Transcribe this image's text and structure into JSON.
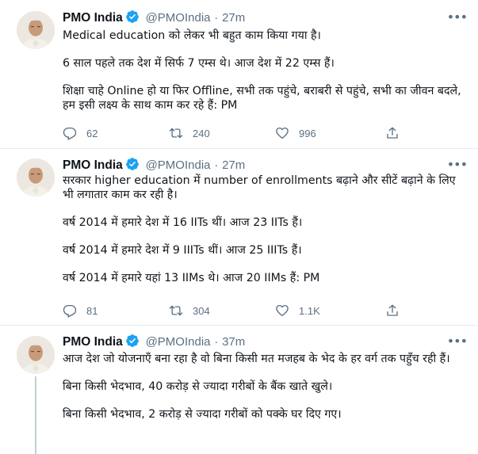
{
  "tweets": [
    {
      "name": "PMO India",
      "handle": "@PMOIndia",
      "time": "27m",
      "paragraphs": [
        "Medical education को लेकर भी बहुत काम किया गया है।",
        "6 साल पहले तक देश में सिर्फ 7 एम्स थे। आज देश में 22 एम्स हैं।",
        "शिक्षा चाहे Online हो या फिर Offline, सभी तक पहुंचे, बराबरी से पहुंचे, सभी का जीवन बदले, हम इसी लक्ष्य के साथ काम कर रहे हैं: PM"
      ],
      "replies": "62",
      "retweets": "240",
      "likes": "996"
    },
    {
      "name": "PMO India",
      "handle": "@PMOIndia",
      "time": "27m",
      "paragraphs": [
        "सरकार higher education में number of enrollments बढ़ाने और सीटें बढ़ाने के लिए भी लगातार काम कर रही है।",
        "वर्ष 2014 में हमारे देश में 16 IITs थीं। आज 23 IITs हैं।",
        "वर्ष 2014 में हमारे देश में 9 IIITs थीं। आज 25 IIITs हैं।",
        "वर्ष 2014 में हमारे यहां 13 IIMs थे। आज 20 IIMs हैं: PM"
      ],
      "replies": "81",
      "retweets": "304",
      "likes": "1.1K"
    },
    {
      "name": "PMO India",
      "handle": "@PMOIndia",
      "time": "37m",
      "paragraphs": [
        "आज देश जो योजनाएँ बना रहा है वो बिना किसी मत मजहब के भेद के हर वर्ग तक पहुँच रही हैं।",
        "बिना किसी भेदभाव, 40 करोड़ से ज्यादा गरीबों के बैंक खाते खुले।",
        "बिना किसी भेदभाव, 2 करोड़ से ज्यादा गरीबों को पक्के घर दिए गए।"
      ]
    }
  ],
  "icons": {
    "more": "more-icon",
    "reply": "reply-icon",
    "retweet": "retweet-icon",
    "like": "heart-icon",
    "share": "share-icon",
    "verified": "verified-badge-icon"
  },
  "colors": {
    "verified": "#1da1f2",
    "muted": "#5b7083",
    "divider": "#e6ecf0"
  }
}
